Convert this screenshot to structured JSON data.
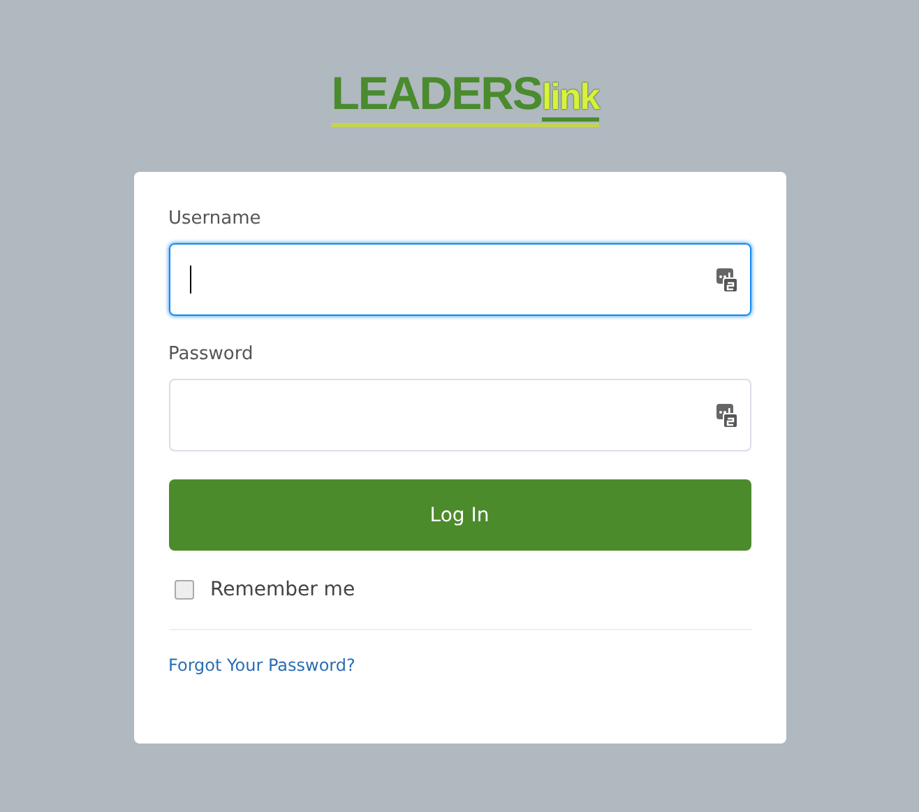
{
  "logo": {
    "primary": "LEADERS",
    "secondary": "link"
  },
  "fields": [
    {
      "label": "Username",
      "focused": true
    },
    {
      "label": "Password",
      "focused": false
    }
  ],
  "login_button": "Log In",
  "remember_me": {
    "label": "Remember me",
    "checked": false
  },
  "forgot_link": "Forgot Your Password?"
}
